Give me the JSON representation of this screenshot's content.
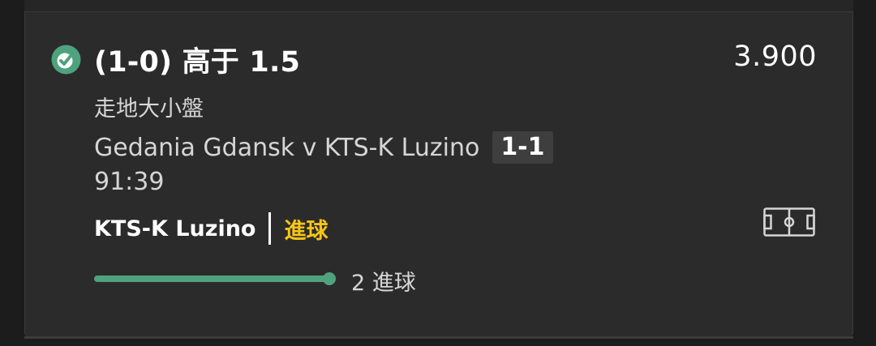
{
  "bet": {
    "selection": "(1-0) 高于 1.5",
    "odds": "3.900",
    "market": "走地大小盤",
    "event": "Gedania Gdansk v KTS-K Luzino",
    "score": "1-1",
    "clock": "91:39",
    "last_event": {
      "team": "KTS-K Luzino",
      "type": "進球"
    },
    "progress": {
      "label": "2 進球",
      "fraction": 1.0
    }
  },
  "icons": {
    "status": "bet-status-check-icon",
    "pitch": "football-pitch-icon"
  },
  "colors": {
    "card_background": "#2b2b2b",
    "accent_green": "#4fa27e",
    "event_yellow": "#f5c518",
    "text_primary": "#ffffff",
    "text_secondary": "#d6d6d6",
    "score_badge": "#3e3e3e"
  }
}
